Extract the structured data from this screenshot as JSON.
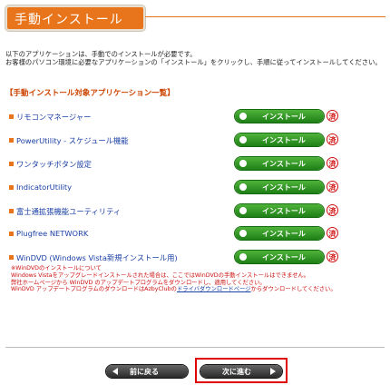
{
  "header": {
    "title": "手動インストール"
  },
  "intro": {
    "line1": "以下のアプリケーションは、手動でのインストールが必要です。",
    "line2": "お客様のパソコン環境に必要なアプリケーションの「インストール」をクリックし、手順に従ってインストールしてください。"
  },
  "list_heading": "【手動インストール対象アプリケーション一覧】",
  "install_label": "インストール",
  "done_mark": "済",
  "apps": [
    {
      "label": "リモコンマネージャー"
    },
    {
      "label": "PowerUtility - スケジュール機能"
    },
    {
      "label": "ワンタッチボタン設定"
    },
    {
      "label": "IndicatorUtility"
    },
    {
      "label": "富士通拡張機能ユーティリティ"
    },
    {
      "label": "Plugfree NETWORK"
    },
    {
      "label": "WinDVD (Windows Vista新規インストール用)"
    }
  ],
  "note": {
    "line1": "※WinDVDのインストールについて",
    "line2": "Windows Vistaをアップグレードインストールされた場合は、ここではWinDVDの手動インストールはできません。",
    "line3": "弊社ホームページから WinDVD のアップデートプログラムをダウンロードし、適用してください。",
    "line4_pre": "WinDVD アップデートプログラムのダウンロードはAzbyClubの",
    "line4_link": "ドライバダウンロードページ",
    "line4_post": "からダウンロードしてください。"
  },
  "nav": {
    "prev_label": "前に戻る",
    "next_label": "次に進む"
  }
}
